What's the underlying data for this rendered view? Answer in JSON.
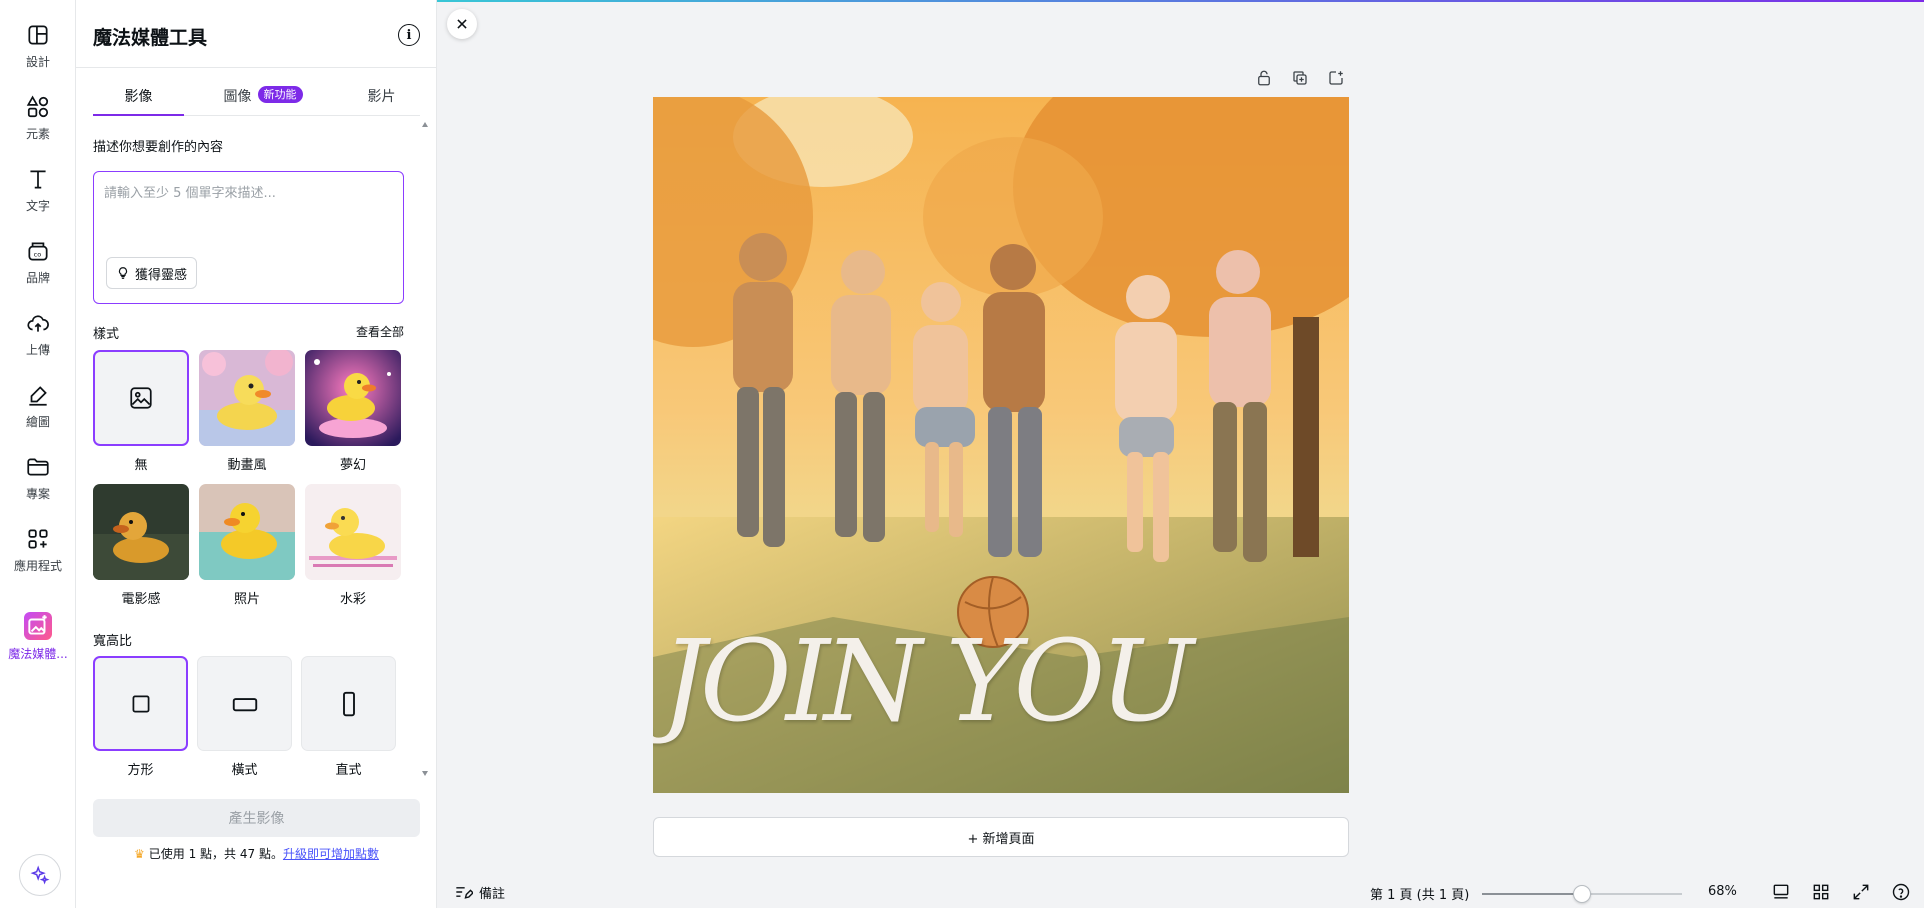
{
  "rail": {
    "items": [
      {
        "label": "設計",
        "icon": "layout-icon"
      },
      {
        "label": "元素",
        "icon": "shapes-icon"
      },
      {
        "label": "文字",
        "icon": "text-icon"
      },
      {
        "label": "品牌",
        "icon": "brand-icon"
      },
      {
        "label": "上傳",
        "icon": "cloud-upload-icon"
      },
      {
        "label": "繪圖",
        "icon": "draw-icon"
      },
      {
        "label": "專案",
        "icon": "folder-icon"
      },
      {
        "label": "應用程式",
        "icon": "apps-icon"
      },
      {
        "label": "魔法媒體...",
        "icon": "magic-media-icon"
      }
    ],
    "assistant_icon": "sparkle-icon"
  },
  "panel": {
    "title": "魔法媒體工具",
    "tabs": [
      {
        "label": "影像",
        "active": true
      },
      {
        "label": "圖像",
        "badge": "新功能"
      },
      {
        "label": "影片"
      }
    ],
    "prompt_label": "描述你想要創作的內容",
    "prompt_placeholder": "請輸入至少 5 個單字來描述...",
    "prompt_value": "",
    "inspire_label": "獲得靈感",
    "style_label": "樣式",
    "view_all": "查看全部",
    "styles": [
      {
        "name": "無",
        "selected": true
      },
      {
        "name": "動畫風"
      },
      {
        "name": "夢幻"
      },
      {
        "name": "電影感"
      },
      {
        "name": "照片"
      },
      {
        "name": "水彩"
      }
    ],
    "ratio_label": "寬高比",
    "ratios": [
      {
        "name": "方形",
        "selected": true
      },
      {
        "name": "橫式"
      },
      {
        "name": "直式"
      }
    ],
    "generate_label": "產生影像",
    "credits_text": "已使用 1 點，共 47 點。",
    "credits_link": "升級即可增加點數"
  },
  "canvas": {
    "design_text": "JOIN YOU",
    "add_page": "+ 新增頁面"
  },
  "footer": {
    "notes": "備註",
    "page_info": "第 1 頁 (共 1 頁)",
    "zoom": "68%",
    "zoom_level": 0.5
  },
  "colors": {
    "accent": "#7d2ae8",
    "selection": "#8b3dff"
  }
}
